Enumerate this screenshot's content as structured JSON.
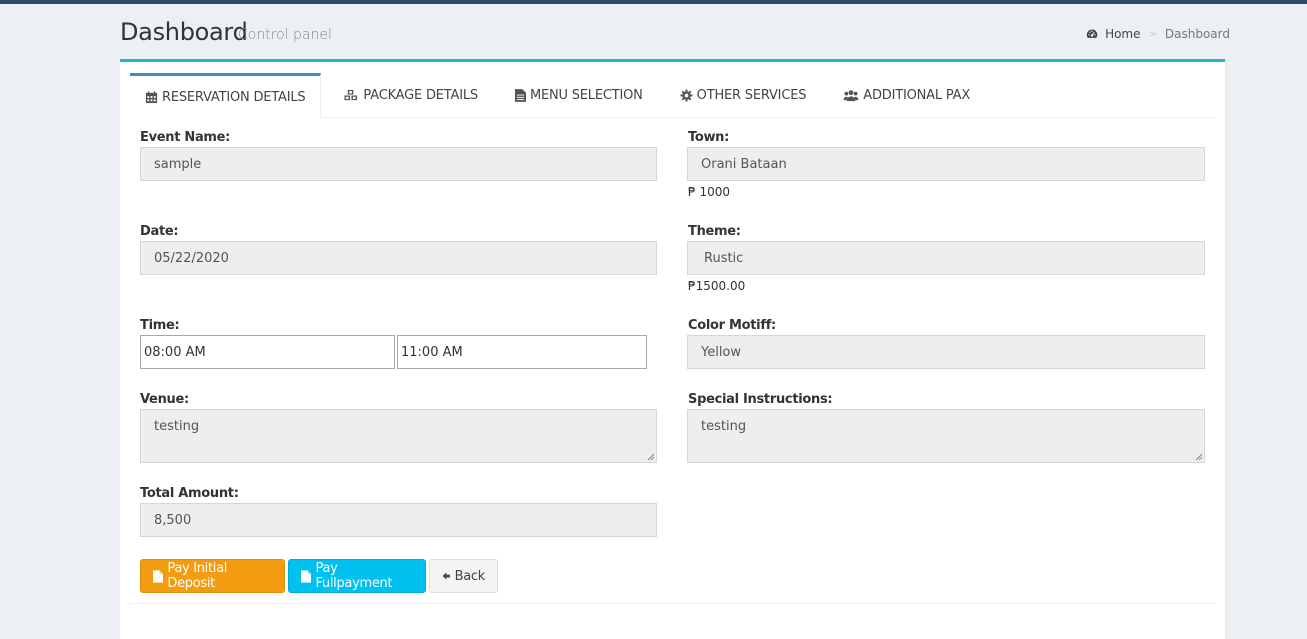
{
  "header": {
    "title": "Dashboard",
    "subtitle": "Control panel",
    "breadcrumb": {
      "home": "Home",
      "separator": ">",
      "current": "Dashboard"
    }
  },
  "tabs": [
    {
      "label": "RESERVATION DETAILS",
      "icon": "calendar-icon",
      "active": true
    },
    {
      "label": "PACKAGE DETAILS",
      "icon": "cubes-icon",
      "active": false
    },
    {
      "label": "MENU SELECTION",
      "icon": "file-text-icon",
      "active": false
    },
    {
      "label": "OTHER SERVICES",
      "icon": "gear-icon",
      "active": false
    },
    {
      "label": "ADDITIONAL PAX",
      "icon": "users-icon",
      "active": false
    }
  ],
  "form": {
    "event_name": {
      "label": "Event Name:",
      "value": "sample"
    },
    "date": {
      "label": "Date:",
      "value": "05/22/2020"
    },
    "time": {
      "label": "Time:",
      "start": "08:00 AM",
      "end": "11:00 AM"
    },
    "venue": {
      "label": "Venue:",
      "value": "testing"
    },
    "total_amount": {
      "label": "Total Amount:",
      "value": "8,500"
    },
    "town": {
      "label": "Town:",
      "value": "Orani Bataan",
      "price": "₱ 1000"
    },
    "theme": {
      "label": "Theme:",
      "value": "Rustic",
      "price": "₱1500.00"
    },
    "color_motif": {
      "label": "Color Motiff:",
      "value": "Yellow"
    },
    "special_instructions": {
      "label": "Special Instructions:",
      "value": "testing"
    }
  },
  "actions": {
    "pay_deposit": "Pay Initial Deposit",
    "pay_full": "Pay Fullpayment",
    "back": "Back"
  },
  "colors": {
    "accent": "#1fb5d8",
    "warning": "#f39c12",
    "info": "#00c0ef",
    "topbar": "#2b4a6b"
  }
}
